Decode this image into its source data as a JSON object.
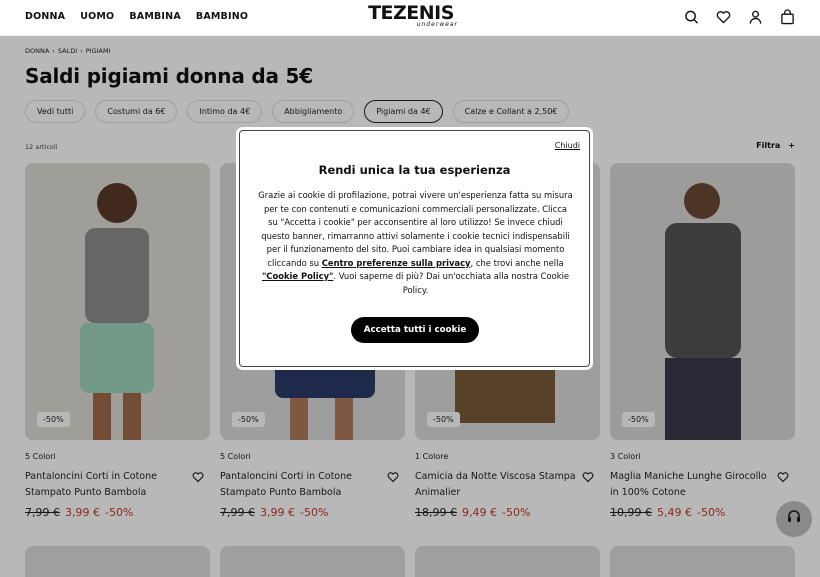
{
  "header": {
    "nav": [
      "DONNA",
      "UOMO",
      "BAMBINA",
      "BAMBINO"
    ],
    "logo": "TEZENIS",
    "logo_sub": "underwear",
    "icons": [
      "search-icon",
      "heart-icon",
      "user-icon",
      "bag-icon"
    ]
  },
  "breadcrumb": [
    "DONNA",
    "›",
    "SALDI",
    "›",
    "PIGIAMI"
  ],
  "page_title": "Saldi pigiami donna da 5€",
  "chips": [
    "Vedi tutti",
    "Costumi da 6€",
    "Intimo da 4€",
    "Abbigliamento",
    "Pigiami da 4€",
    "Calze e Collant a 2,50€"
  ],
  "active_chip": "Pigiami da 4€",
  "count": "12 articoli",
  "filter": {
    "label": "Filtra",
    "icon": "+"
  },
  "products": [
    {
      "badge": "-50%",
      "colors": "5 Colori",
      "name": "Pantaloncini Corti in Cotone Stampato Punto Bambola",
      "old": "7,99 €",
      "new": "3,99 €",
      "disc": "-50%"
    },
    {
      "badge": "-50%",
      "colors": "5 Colori",
      "name": "Pantaloncini Corti in Cotone Stampato Punto Bambola",
      "old": "7,99 €",
      "new": "3,99 €",
      "disc": "-50%"
    },
    {
      "badge": "-50%",
      "colors": "1 Colore",
      "name": "Camicia da Notte Viscosa Stampa Animalier",
      "old": "18,99 €",
      "new": "9,49 €",
      "disc": "-50%"
    },
    {
      "badge": "-50%",
      "colors": "3 Colori",
      "name": "Maglia Maniche Lunghe Girocollo in 100% Cotone",
      "old": "10,99 €",
      "new": "5,49 €",
      "disc": "-50%"
    }
  ],
  "modal": {
    "close": "Chiudi",
    "title": "Rendi unica la tua esperienza",
    "text1": "Grazie ai cookie di profilazione, potrai vivere un'esperienza fatta su misura per te con contenuti e comunicazioni commerciali personalizzate. Clicca su \"Accetta i cookie\" per acconsentire al loro utilizzo! Se invece chiudi questo banner, rimarranno attivi solamente i cookie tecnici indispensabili per il funzionamento del sito. Puoi cambiare idea in qualsiasi momento cliccando su ",
    "link1": "Centro preferenze sulla privacy",
    "text2": ", che trovi anche nella ",
    "link2": "\"Cookie Policy\"",
    "text3": ". Vuoi saperne di più? Dai un'occhiata alla nostra Cookie Policy.",
    "accept": "Accetta tutti i cookie"
  },
  "colors": {
    "sale": "#c0392b",
    "accent": "#000000"
  }
}
